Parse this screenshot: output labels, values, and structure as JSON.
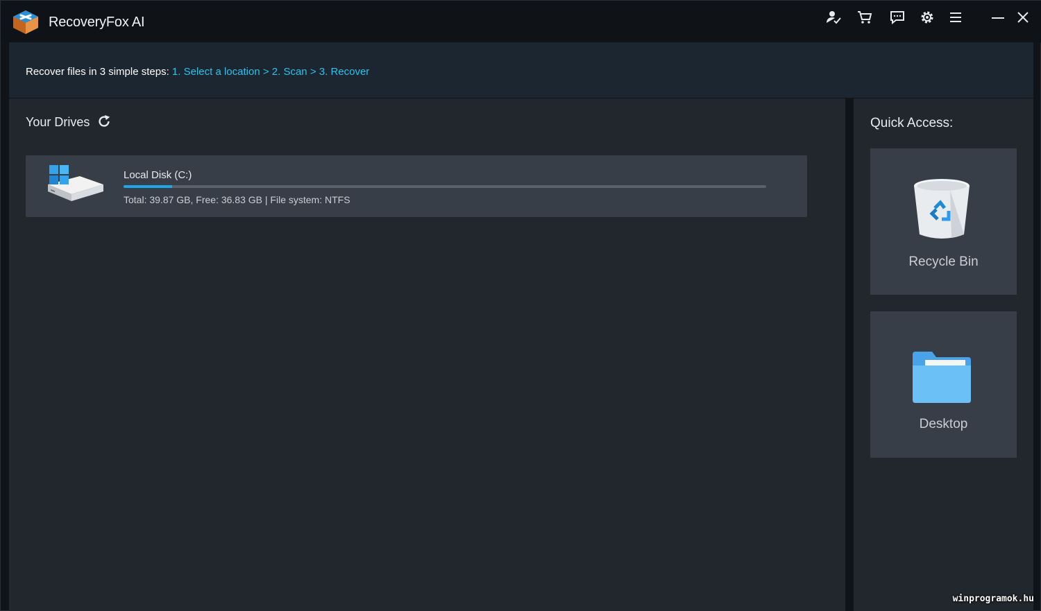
{
  "app": {
    "title": "RecoveryFox AI"
  },
  "titlebar_icons": [
    "account-icon",
    "cart-icon",
    "feedback-icon",
    "settings-icon",
    "menu-icon",
    "minimize-icon",
    "close-icon"
  ],
  "steps": {
    "prefix": "Recover files in 3 simple steps:",
    "step1": "1. Select a location",
    "sep1": ">",
    "step2": "2. Scan",
    "sep2": ">",
    "step3": "3. Recover"
  },
  "drives": {
    "title": "Your Drives",
    "items": [
      {
        "name": "Local Disk (C:)",
        "info": "Total: 39.87 GB, Free: 36.83 GB | File system: NTFS",
        "used_fraction": 0.076
      }
    ]
  },
  "quick_access": {
    "title": "Quick Access:",
    "items": [
      {
        "label": "Recycle Bin",
        "icon": "recycle-bin-icon"
      },
      {
        "label": "Desktop",
        "icon": "folder-icon"
      }
    ]
  },
  "colors": {
    "accent": "#2fc0e8",
    "progress": "#1ea6e8",
    "panel": "#22272e",
    "card": "#383e47"
  },
  "watermark": "winprogramok.hu"
}
